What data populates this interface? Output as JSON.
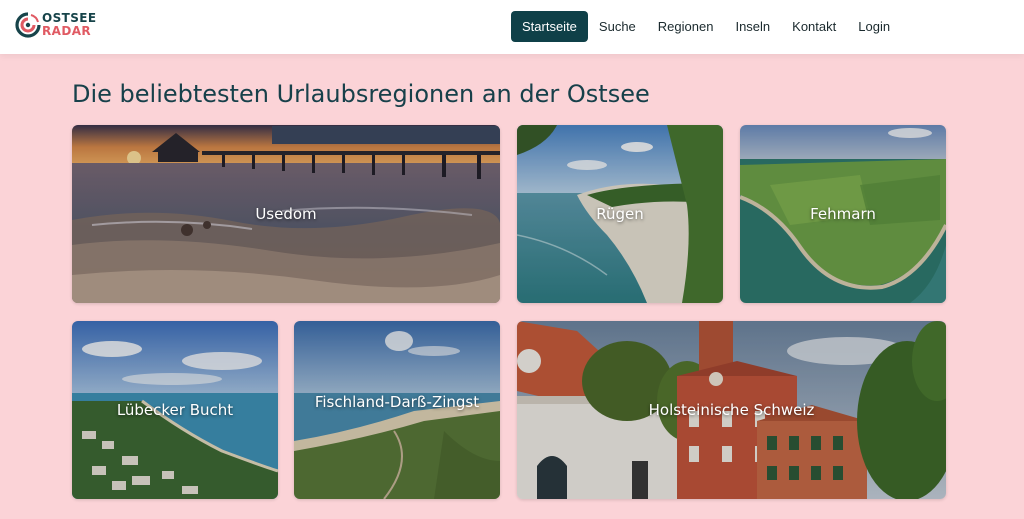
{
  "header": {
    "logo": {
      "line1": "OSTSEE",
      "line2": "RADAR"
    },
    "nav": [
      {
        "label": "Startseite",
        "active": true
      },
      {
        "label": "Suche"
      },
      {
        "label": "Regionen"
      },
      {
        "label": "Inseln"
      },
      {
        "label": "Kontakt"
      },
      {
        "label": "Login"
      }
    ]
  },
  "main": {
    "title": "Die beliebtesten Urlaubsregionen an der Ostsee",
    "cards": [
      {
        "label": "Usedom"
      },
      {
        "label": "Rügen"
      },
      {
        "label": "Fehmarn"
      },
      {
        "label": "Lübecker Bucht"
      },
      {
        "label": "Fischland-Darß-Zingst"
      },
      {
        "label": "Holsteinische Schweiz"
      }
    ]
  },
  "colors": {
    "page_background": "#fbd3d7",
    "nav_active": "#0f4048",
    "title": "#17404a",
    "logo_teal": "#17444a",
    "logo_red": "#e05a63"
  }
}
